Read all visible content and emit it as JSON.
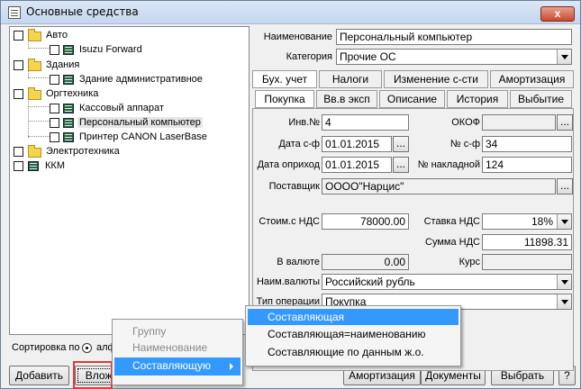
{
  "window": {
    "title": "Основные средства",
    "close_label": "x"
  },
  "tree": {
    "auto": "Авто",
    "isuzu": "Isuzu Forward",
    "buildings": "Здания",
    "admin_building": "Здание административное",
    "office": "Оргтехника",
    "cash_register": "Кассовый аппарат",
    "pc": "Персональный компьютер",
    "printer": "Принтер CANON LaserBase",
    "electronics": "Электротехника",
    "kkm": "ККМ"
  },
  "sort": {
    "label": "Сортировка по",
    "option": "алф"
  },
  "buttons": {
    "add": "Добавить",
    "nest": "Вложи",
    "amortization": "Амортизация",
    "documents": "Документы",
    "choose": "Выбрать",
    "help": "?"
  },
  "form": {
    "name_label": "Наименование",
    "name_value": "Персональный компьютер",
    "category_label": "Категория",
    "category_value": "Прочие ОС",
    "inv_label": "Инв.№",
    "inv_value": "4",
    "okof_label": "ОКОФ",
    "okof_value": "",
    "date_invoice_label": "Дата с-ф",
    "date_invoice_value": "01.01.2015",
    "invoice_no_label": "№ с-ф",
    "invoice_no_value": "34",
    "date_receipt_label": "Дата оприход",
    "date_receipt_value": "01.01.2015",
    "waybill_label": "№ накладной",
    "waybill_value": "124",
    "supplier_label": "Поставщик",
    "supplier_value": "ОООО\"Нарцис\"",
    "cost_label": "Стоим.с НДС",
    "cost_value": "78000.00",
    "vat_rate_label": "Ставка НДС",
    "vat_rate_value": "18%",
    "vat_sum_label": "Сумма НДС",
    "vat_sum_value": "11898.31",
    "currency_amount_label": "В валюте",
    "currency_amount_value": "0.00",
    "rate_label": "Курс",
    "rate_value": "",
    "currency_name_label": "Наим.валюты",
    "currency_name_value": "Российский рубль",
    "operation_label": "Тип операции",
    "operation_value": "Покупка",
    "ellipsis": "..."
  },
  "tabs_row1": [
    "Бух. учет",
    "Налоги",
    "Изменение с-сти",
    "Амортизация"
  ],
  "tabs_row2": [
    "Покупка",
    "Вв.в эксп",
    "Описание",
    "История",
    "Выбытие"
  ],
  "context_menu": {
    "items": [
      "Группу",
      "Наименование",
      "Составляющую"
    ]
  },
  "submenu": {
    "items": [
      "Составляющая",
      "Составляющая=наименованию",
      "Составляющие по данным ж.о."
    ]
  }
}
